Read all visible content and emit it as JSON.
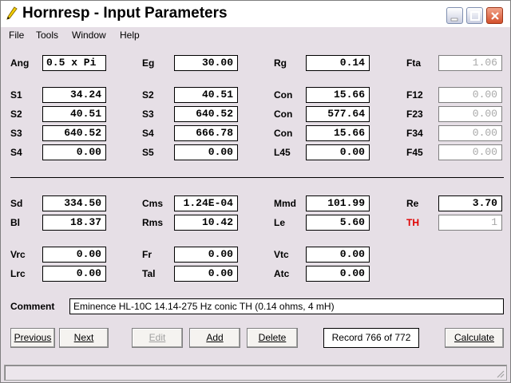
{
  "window": {
    "title": "Hornresp - Input Parameters"
  },
  "menu": [
    "File",
    "Tools",
    "Window",
    "Help"
  ],
  "params": {
    "Ang": "0.5 x Pi",
    "Eg": "30.00",
    "Rg": "0.14",
    "Fta": "1.06",
    "S1": "34.24",
    "S2a": "40.51",
    "Con1": "15.66",
    "F12": "0.00",
    "S2": "40.51",
    "S3a": "640.52",
    "Con2": "577.64",
    "F23": "0.00",
    "S3": "640.52",
    "S4a": "666.78",
    "Con3": "15.66",
    "F34": "0.00",
    "S4": "0.00",
    "S5": "0.00",
    "L45": "0.00",
    "F45": "0.00",
    "Sd": "334.50",
    "Cms": "1.24E-04",
    "Mmd": "101.99",
    "Re": "3.70",
    "Bl": "18.37",
    "Rms": "10.42",
    "Le": "5.60",
    "TH": "1",
    "Vrc": "0.00",
    "Fr": "0.00",
    "Vtc": "0.00",
    "Lrc": "0.00",
    "Tal": "0.00",
    "Atc": "0.00"
  },
  "labels": {
    "Ang": "Ang",
    "Eg": "Eg",
    "Rg": "Rg",
    "Fta": "Fta",
    "S1": "S1",
    "S2": "S2",
    "S3": "S3",
    "S4": "S4",
    "S5": "S5",
    "Con": "Con",
    "F12": "F12",
    "F23": "F23",
    "F34": "F34",
    "F45": "F45",
    "L45": "L45",
    "Sd": "Sd",
    "Cms": "Cms",
    "Mmd": "Mmd",
    "Re": "Re",
    "Bl": "Bl",
    "Rms": "Rms",
    "Le": "Le",
    "TH": "TH",
    "Vrc": "Vrc",
    "Fr": "Fr",
    "Vtc": "Vtc",
    "Lrc": "Lrc",
    "Tal": "Tal",
    "Atc": "Atc",
    "Comment": "Comment"
  },
  "comment": "Eminence HL-10C 14.14-275 Hz conic TH (0.14 ohms, 4 mH)",
  "buttons": {
    "previous": "Previous",
    "next": "Next",
    "edit": "Edit",
    "add": "Add",
    "delete": "Delete",
    "calculate": "Calculate"
  },
  "record": "Record 766 of 772",
  "colors": {
    "accent_label": "#e00000",
    "window_bg": "#e6dfe6"
  }
}
